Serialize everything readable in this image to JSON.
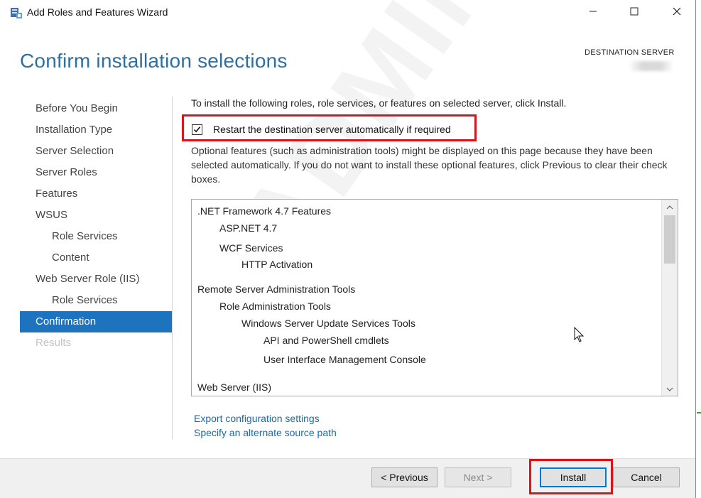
{
  "window": {
    "title": "Add Roles and Features Wizard",
    "controls": [
      "minimize",
      "maximize",
      "close"
    ]
  },
  "header": {
    "page_title": "Confirm installation selections",
    "destination_label": "DESTINATION SERVER"
  },
  "nav": {
    "items": [
      {
        "label": "Before You Begin",
        "level": 0,
        "state": "normal"
      },
      {
        "label": "Installation Type",
        "level": 0,
        "state": "normal"
      },
      {
        "label": "Server Selection",
        "level": 0,
        "state": "normal"
      },
      {
        "label": "Server Roles",
        "level": 0,
        "state": "normal"
      },
      {
        "label": "Features",
        "level": 0,
        "state": "normal"
      },
      {
        "label": "WSUS",
        "level": 0,
        "state": "normal"
      },
      {
        "label": "Role Services",
        "level": 1,
        "state": "normal"
      },
      {
        "label": "Content",
        "level": 1,
        "state": "normal"
      },
      {
        "label": "Web Server Role (IIS)",
        "level": 0,
        "state": "normal"
      },
      {
        "label": "Role Services",
        "level": 1,
        "state": "normal"
      },
      {
        "label": "Confirmation",
        "level": 0,
        "state": "active"
      },
      {
        "label": "Results",
        "level": 0,
        "state": "disabled"
      }
    ]
  },
  "content": {
    "intro": "To install the following roles, role services, or features on selected server, click Install.",
    "restart_checkbox": {
      "label": "Restart the destination server automatically if required",
      "checked": true
    },
    "optional_text": "Optional features (such as administration tools) might be displayed on this page because they have been selected automatically. If you do not want to install these optional features, click Previous to clear their check boxes.",
    "features": [
      {
        "label": ".NET Framework 4.7 Features",
        "level": 0
      },
      {
        "label": "ASP.NET 4.7",
        "level": 1
      },
      {
        "label": "WCF Services",
        "level": 1
      },
      {
        "label": "HTTP Activation",
        "level": 2
      },
      {
        "label": "Remote Server Administration Tools",
        "level": 0
      },
      {
        "label": "Role Administration Tools",
        "level": 1
      },
      {
        "label": "Windows Server Update Services Tools",
        "level": 2
      },
      {
        "label": "API and PowerShell cmdlets",
        "level": 3
      },
      {
        "label": "User Interface Management Console",
        "level": 3
      },
      {
        "label": "Web Server (IIS)",
        "level": 0
      }
    ],
    "links": {
      "export": "Export configuration settings",
      "alternate_source": "Specify an alternate source path"
    }
  },
  "footer": {
    "previous": "< Previous",
    "next": "Next >",
    "install": "Install",
    "cancel": "Cancel",
    "next_enabled": false
  },
  "colors": {
    "title_blue": "#2e6f9e",
    "nav_active": "#1e73be",
    "link_blue": "#1a6aa5",
    "highlight_red": "#d9141b"
  },
  "watermark": "ADMIN"
}
